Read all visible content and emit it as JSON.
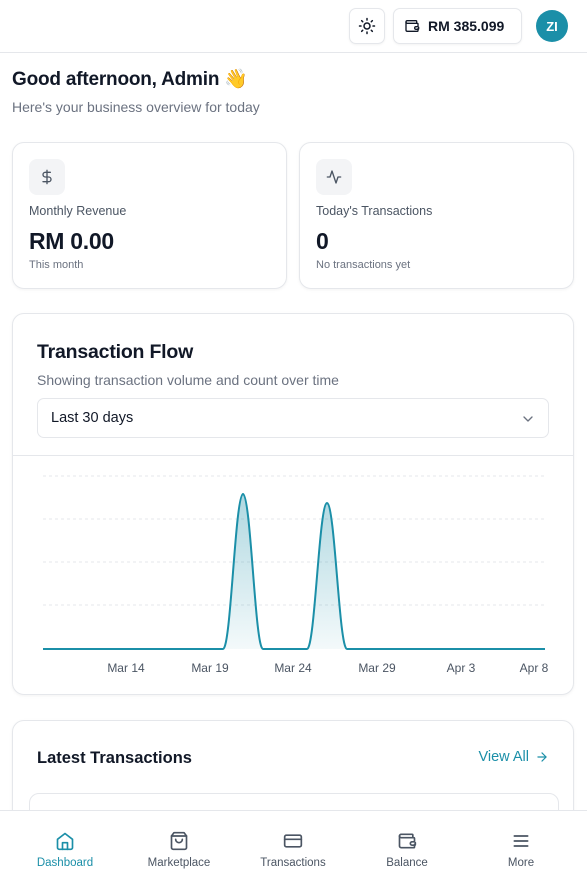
{
  "header": {
    "theme_icon": "sun-icon",
    "wallet_icon": "wallet-icon",
    "balance": "RM 385.099",
    "avatar_initials": "ZI"
  },
  "greeting": {
    "title": "Good afternoon, Admin",
    "emoji": "👋",
    "subtitle": "Here's your business overview for today"
  },
  "stats": [
    {
      "icon": "dollar-icon",
      "label": "Monthly Revenue",
      "value": "RM 0.00",
      "sub": "This month"
    },
    {
      "icon": "activity-icon",
      "label": "Today's Transactions",
      "value": "0",
      "sub": "No transactions yet"
    }
  ],
  "flow": {
    "title": "Transaction Flow",
    "subtitle": "Showing transaction volume and count over time",
    "range_selected": "Last 30 days"
  },
  "chart_data": {
    "type": "area",
    "x_ticks": [
      "Mar 14",
      "Mar 19",
      "Mar 24",
      "Mar 29",
      "Apr 3",
      "Apr 8"
    ],
    "series_color": "#1b8fa8",
    "grid": true,
    "peaks": [
      {
        "x": "Mar 21",
        "relative_height": 0.88
      },
      {
        "x": "Mar 26",
        "relative_height": 0.8
      }
    ]
  },
  "latest": {
    "title": "Latest Transactions",
    "view_all": "View All"
  },
  "nav": [
    {
      "label": "Dashboard",
      "icon": "home-icon",
      "active": true
    },
    {
      "label": "Marketplace",
      "icon": "shopping-bag-icon",
      "active": false
    },
    {
      "label": "Transactions",
      "icon": "credit-card-icon",
      "active": false
    },
    {
      "label": "Balance",
      "icon": "wallet-icon",
      "active": false
    },
    {
      "label": "More",
      "icon": "menu-icon",
      "active": false
    }
  ],
  "colors": {
    "accent": "#1b8fa8",
    "text": "#111827",
    "muted": "#6b7280",
    "border": "#e5e7eb"
  }
}
